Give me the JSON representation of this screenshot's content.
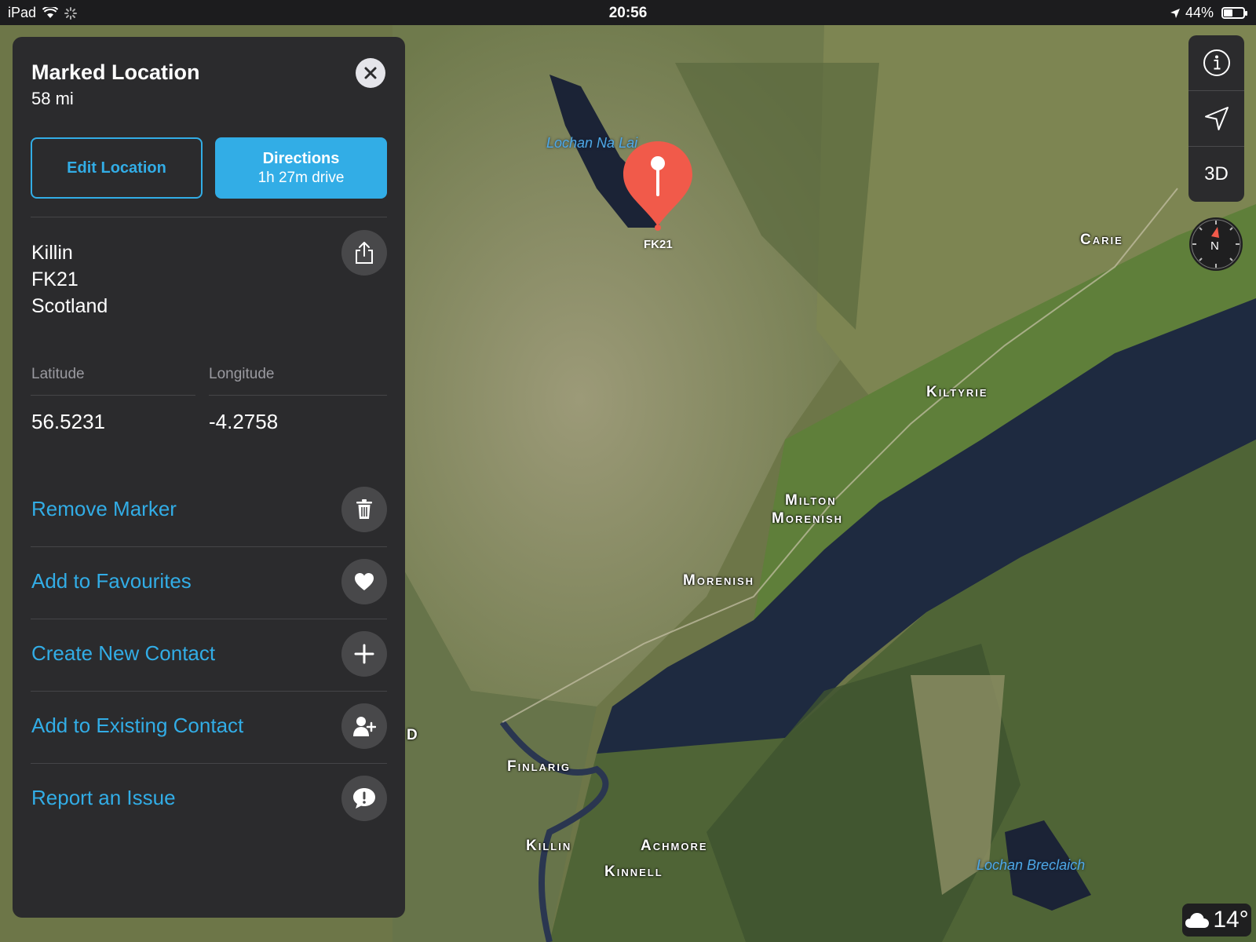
{
  "status_bar": {
    "device": "iPad",
    "time": "20:56",
    "battery": "44%",
    "battery_level": 0.44
  },
  "panel": {
    "title": "Marked Location",
    "distance": "58 mi",
    "edit_button": "Edit Location",
    "directions_button": "Directions",
    "directions_time": "1h 27m drive",
    "address": [
      "Killin",
      "FK21",
      "Scotland"
    ],
    "latitude_label": "Latitude",
    "longitude_label": "Longitude",
    "latitude": "56.5231",
    "longitude": "-4.2758",
    "actions": [
      {
        "label": "Remove Marker",
        "icon": "trash-icon"
      },
      {
        "label": "Add to Favourites",
        "icon": "heart-icon"
      },
      {
        "label": "Create New Contact",
        "icon": "plus-icon"
      },
      {
        "label": "Add to Existing Contact",
        "icon": "add-person-icon"
      },
      {
        "label": "Report an Issue",
        "icon": "exclamation-bubble-icon"
      }
    ]
  },
  "map": {
    "pin_label": "FK21",
    "places": [
      "Carie",
      "Kiltyrie",
      "Milton",
      "Morenish",
      "Morenish",
      "Finlarig",
      "Killin",
      "Achmore",
      "Kinnell",
      "D"
    ],
    "water_labels": [
      "Lochan Na Lai",
      "Lochan Breclaich"
    ],
    "controls": {
      "mode_3d": "3D",
      "compass_letter": "N"
    },
    "weather": "14°"
  },
  "colors": {
    "accent": "#32ade6",
    "pin": "#f15a4a",
    "panel_bg": "#2b2b2d"
  }
}
